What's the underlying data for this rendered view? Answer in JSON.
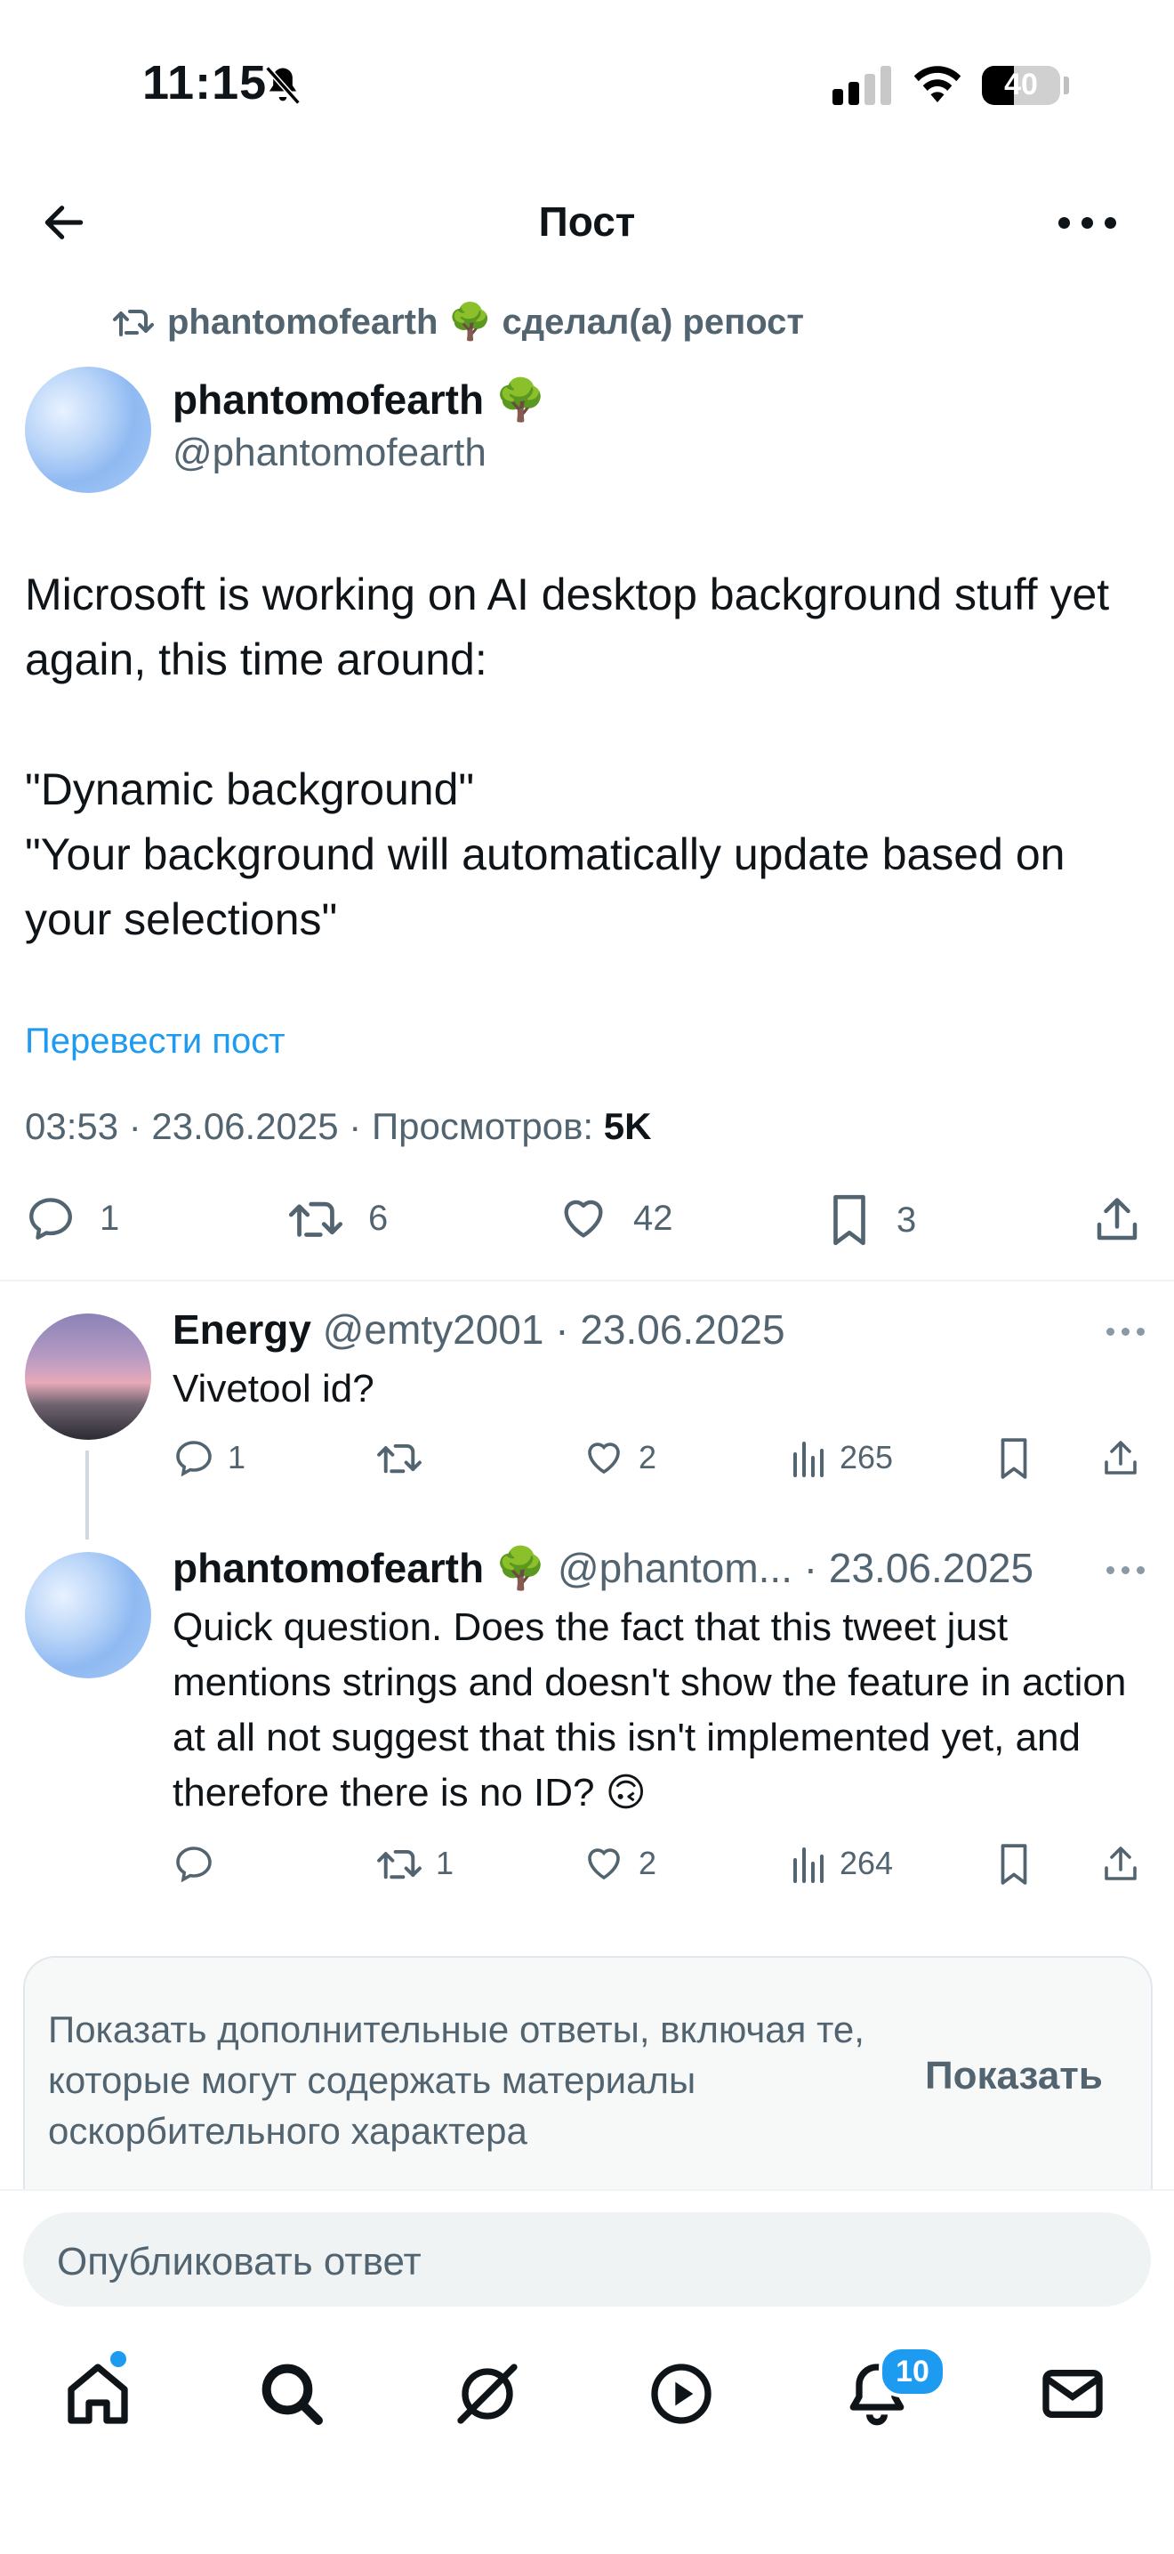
{
  "status_bar": {
    "time": "11:15",
    "battery": "40"
  },
  "header": {
    "title": "Пост"
  },
  "post": {
    "repost_label": "phantomofearth 🌳 сделал(а) репост",
    "author_name": "phantomofearth 🌳",
    "author_handle": "@phantomofearth",
    "text": "Microsoft is working on AI desktop background stuff yet again, this time around:\n\n\"Dynamic background\"\n\"Your background will automatically update based on your selections\"",
    "translate_label": "Перевести пост",
    "meta_prefix": "03:53 · 23.06.2025 · Просмотров: ",
    "views": "5K",
    "stats": {
      "replies": "1",
      "reposts": "6",
      "likes": "42",
      "bookmarks": "3"
    }
  },
  "replies": [
    {
      "name": "Energy",
      "handle_date": "@emty2001 · 23.06.2025",
      "text": "Vivetool id?",
      "stats": {
        "replies": "1",
        "reposts": "",
        "likes": "2",
        "views": "265"
      }
    },
    {
      "name": "phantomofearth 🌳",
      "handle_date": "@phantom... · 23.06.2025",
      "text": "Quick question. Does the fact that this tweet just mentions strings and doesn't show the feature in action at all not suggest that this isn't implemented yet, and therefore there is no ID? 🙃",
      "stats": {
        "replies": "",
        "reposts": "1",
        "likes": "2",
        "views": "264"
      }
    }
  ],
  "notice": {
    "text": "Показать дополнительные ответы, включая те, которые могут содержать материалы оскорбительного характера",
    "button": "Показать"
  },
  "reply_bar": {
    "placeholder": "Опубликовать ответ"
  },
  "tab_bar": {
    "notifications_badge": "10"
  }
}
